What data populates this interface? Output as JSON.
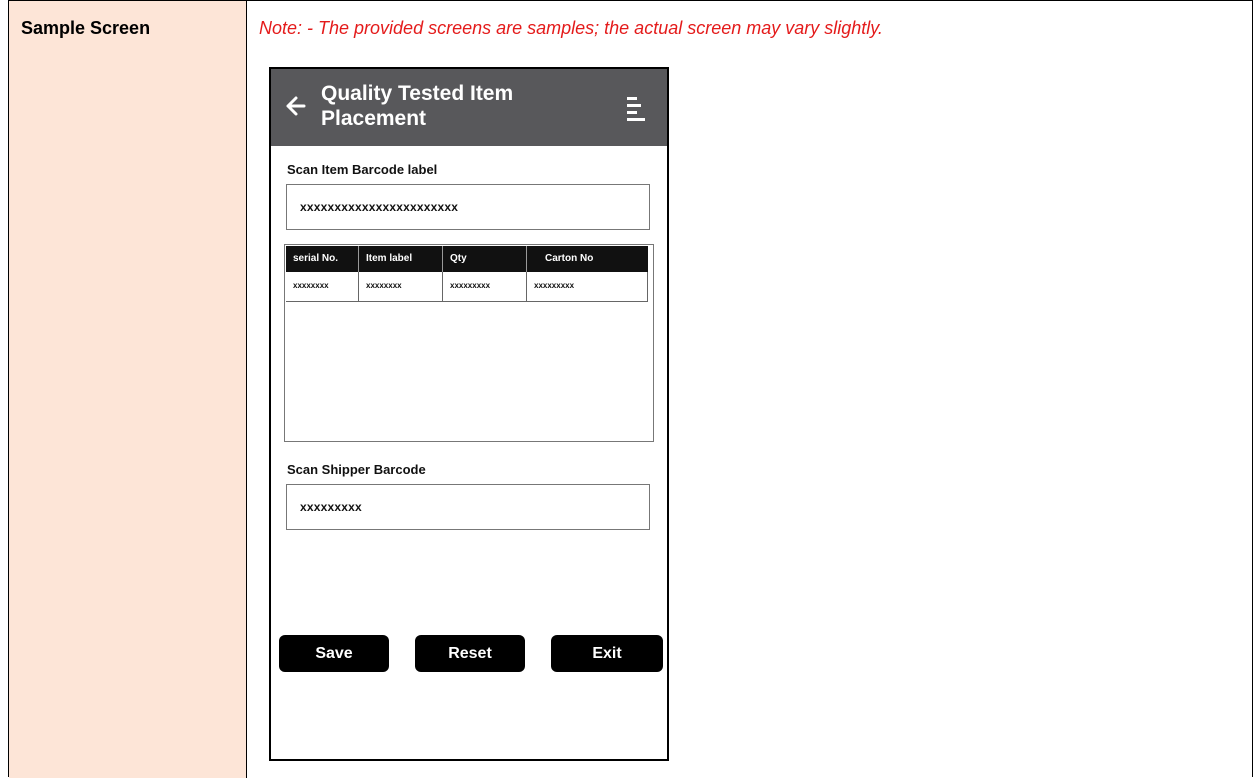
{
  "doc": {
    "label": "Sample Screen",
    "note": "Note: - The provided screens are samples; the actual screen may vary slightly."
  },
  "app": {
    "title": "Quality Tested Item Placement",
    "back_icon": "back-arrow-icon",
    "menu_icon": "menu-icon",
    "header_color": "#58585b"
  },
  "item_barcode": {
    "label": "Scan Item Barcode label",
    "value": "xxxxxxxxxxxxxxxxxxxxxxx"
  },
  "table": {
    "headers": [
      "serial No.",
      "Item label",
      "Qty",
      "Carton No"
    ],
    "rows": [
      [
        "xxxxxxxx",
        "xxxxxxxx",
        "xxxxxxxxx",
        "xxxxxxxxx"
      ]
    ]
  },
  "shipper_barcode": {
    "label": "Scan Shipper Barcode",
    "value": "xxxxxxxxx"
  },
  "buttons": {
    "save": "Save",
    "reset": "Reset",
    "exit": "Exit"
  }
}
